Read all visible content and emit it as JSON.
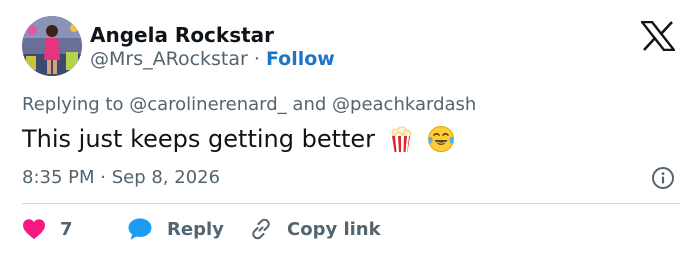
{
  "user": {
    "display_name": "Angela Rockstar",
    "handle": "@Mrs_ARockstar",
    "separator": "·",
    "follow_label": "Follow"
  },
  "reply_context": {
    "prefix": "Replying to",
    "mention_1": "@carolinerenard_",
    "conjunction": "and",
    "mention_2": "@peachkardash"
  },
  "tweet": {
    "text": "This just keeps getting better",
    "emojis": [
      "popcorn-emoji",
      "tears-of-joy-emoji"
    ],
    "timestamp": "8:35 PM · Sep 8, 2026"
  },
  "actions": {
    "like_count": "7",
    "reply_label": "Reply",
    "copy_link_label": "Copy link"
  },
  "icons": {
    "brand": "x-logo-icon",
    "info": "info-icon",
    "like": "heart-icon",
    "reply": "speech-bubble-icon",
    "copy": "link-icon"
  },
  "colors": {
    "text_primary": "#0f1419",
    "text_secondary": "#536471",
    "link_blue": "#1d74c8",
    "heart_red": "#f91880",
    "reply_blue": "#1d9bf0",
    "divider": "#cfd9de"
  }
}
